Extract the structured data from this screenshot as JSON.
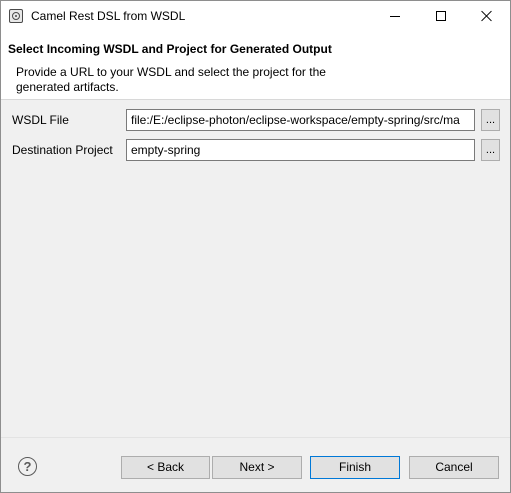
{
  "window": {
    "title": "Camel Rest DSL from WSDL",
    "icon": "camel-app-icon",
    "controls": {
      "minimize_icon": "minimize-icon",
      "maximize_icon": "maximize-icon",
      "close_icon": "close-icon"
    }
  },
  "banner": {
    "title": "Select Incoming WSDL and Project for Generated Output",
    "description": "Provide a URL to your WSDL and select the project for the generated artifacts."
  },
  "form": {
    "wsdl_file": {
      "label": "WSDL File",
      "value": "file:/E:/eclipse-photon/eclipse-workspace/empty-spring/src/ma",
      "browse_label": "..."
    },
    "destination_project": {
      "label": "Destination Project",
      "value": "empty-spring",
      "browse_label": "..."
    }
  },
  "footer": {
    "help_glyph": "?",
    "back_label": "< Back",
    "next_label": "Next >",
    "finish_label": "Finish",
    "cancel_label": "Cancel"
  },
  "colors": {
    "dialog_background": "#f0f0f0",
    "banner_background": "#ffffff",
    "default_button_border": "#0078d7"
  }
}
